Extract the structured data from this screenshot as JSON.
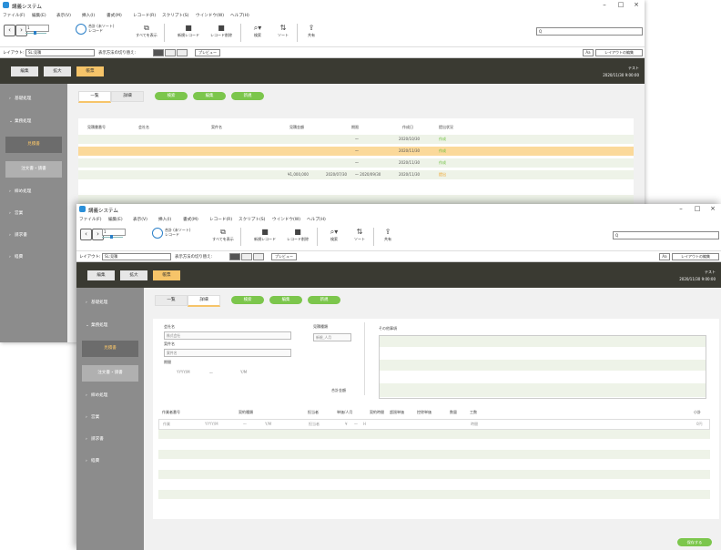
{
  "app": {
    "title": "講義システム"
  },
  "menu": [
    "ファイル(F)",
    "編集(E)",
    "表示(V)",
    "挿入(I)",
    "書式(M)",
    "レコード(R)",
    "スクリプト(S)",
    "ウインドウ(W)",
    "ヘルプ(H)"
  ],
  "toolbar": {
    "record_info": [
      "合計 (未ソート)",
      "レコード"
    ],
    "buttons": [
      {
        "label": "すべてを表示",
        "icon": "show-all-icon"
      },
      {
        "label": "新規レコード",
        "icon": "new-record-icon"
      },
      {
        "label": "レコード削除",
        "icon": "delete-record-icon"
      },
      {
        "label": "検索",
        "icon": "search-icon"
      },
      {
        "label": "ソート",
        "icon": "sort-icon"
      },
      {
        "label": "共有",
        "icon": "share-icon"
      }
    ],
    "search_placeholder": "Q"
  },
  "layoutbar": {
    "label": "レイアウト:",
    "layout_value": "SL:見積",
    "view_label": "表示方法の切り替え:",
    "preview": "プレビュー",
    "aa": "Aa",
    "edit_layout": "レイアウトの編集"
  },
  "header": {
    "tabs": [
      "編集",
      "拡大",
      "帳票"
    ],
    "meta": [
      "テスト",
      "2020/11/30 9:00:00"
    ]
  },
  "sidebar": {
    "items": [
      "基礎処理",
      "業務処理",
      "締め処理",
      "営業",
      "請求書",
      "経費"
    ],
    "subs": [
      "見積書",
      "注文書・請書"
    ]
  },
  "back": {
    "segments": [
      "一覧",
      "詳細"
    ],
    "actions": [
      "検索",
      "編集",
      "新規"
    ],
    "table_headers": [
      "見積書番号",
      "会社名",
      "案件名",
      "見積金額",
      "期限",
      "作成日",
      "提出状況"
    ],
    "rows": [
      {
        "amount": "",
        "deadline": "〜",
        "date": "2020/10/30",
        "status": "作成"
      },
      {
        "amount": "",
        "deadline": "〜",
        "date": "2020/11/30",
        "status": "作成"
      },
      {
        "amount": "",
        "deadline": "〜",
        "date": "2020/11/30",
        "status": "作成"
      },
      {
        "amount": "¥1,000,000",
        "start": "2020/07/30",
        "deadline": "〜 2020/09/30",
        "date": "2020/11/30",
        "status": "提出"
      }
    ]
  },
  "front": {
    "segments": [
      "一覧",
      "詳細"
    ],
    "actions": [
      "検索",
      "編集",
      "新規"
    ],
    "fields": {
      "company_label": "会社名",
      "company_value": "株式会社",
      "project_label": "案件名",
      "project_value": "案件名",
      "period_label": "期間",
      "period_from": "YYYY/M",
      "period_sep": "〜",
      "period_to": "Y/M",
      "type_label": "見積種類",
      "type_value": "新規_人月",
      "amount_label": "合計金額",
      "notes_label": "その他事項"
    },
    "detail_headers": [
      "作業者番号",
      "契約種類",
      "担当者",
      "単価/人月",
      "契約時間",
      "超過単価",
      "控除単価",
      "数量",
      "工数",
      "小計"
    ],
    "detail_row": [
      "作業",
      "YYYY/M",
      "〜",
      "Y/M",
      "担当者",
      "¥",
      "〜",
      "H",
      "時間",
      "0円"
    ],
    "save": "保存する"
  }
}
